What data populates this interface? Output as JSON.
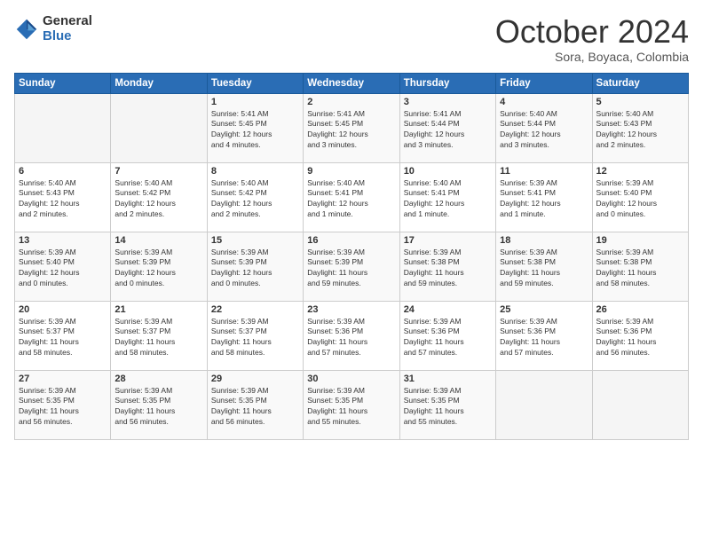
{
  "logo": {
    "general": "General",
    "blue": "Blue"
  },
  "header": {
    "month": "October 2024",
    "location": "Sora, Boyaca, Colombia"
  },
  "weekdays": [
    "Sunday",
    "Monday",
    "Tuesday",
    "Wednesday",
    "Thursday",
    "Friday",
    "Saturday"
  ],
  "weeks": [
    [
      {
        "day": "",
        "info": ""
      },
      {
        "day": "",
        "info": ""
      },
      {
        "day": "1",
        "info": "Sunrise: 5:41 AM\nSunset: 5:45 PM\nDaylight: 12 hours\nand 4 minutes."
      },
      {
        "day": "2",
        "info": "Sunrise: 5:41 AM\nSunset: 5:45 PM\nDaylight: 12 hours\nand 3 minutes."
      },
      {
        "day": "3",
        "info": "Sunrise: 5:41 AM\nSunset: 5:44 PM\nDaylight: 12 hours\nand 3 minutes."
      },
      {
        "day": "4",
        "info": "Sunrise: 5:40 AM\nSunset: 5:44 PM\nDaylight: 12 hours\nand 3 minutes."
      },
      {
        "day": "5",
        "info": "Sunrise: 5:40 AM\nSunset: 5:43 PM\nDaylight: 12 hours\nand 2 minutes."
      }
    ],
    [
      {
        "day": "6",
        "info": "Sunrise: 5:40 AM\nSunset: 5:43 PM\nDaylight: 12 hours\nand 2 minutes."
      },
      {
        "day": "7",
        "info": "Sunrise: 5:40 AM\nSunset: 5:42 PM\nDaylight: 12 hours\nand 2 minutes."
      },
      {
        "day": "8",
        "info": "Sunrise: 5:40 AM\nSunset: 5:42 PM\nDaylight: 12 hours\nand 2 minutes."
      },
      {
        "day": "9",
        "info": "Sunrise: 5:40 AM\nSunset: 5:41 PM\nDaylight: 12 hours\nand 1 minute."
      },
      {
        "day": "10",
        "info": "Sunrise: 5:40 AM\nSunset: 5:41 PM\nDaylight: 12 hours\nand 1 minute."
      },
      {
        "day": "11",
        "info": "Sunrise: 5:39 AM\nSunset: 5:41 PM\nDaylight: 12 hours\nand 1 minute."
      },
      {
        "day": "12",
        "info": "Sunrise: 5:39 AM\nSunset: 5:40 PM\nDaylight: 12 hours\nand 0 minutes."
      }
    ],
    [
      {
        "day": "13",
        "info": "Sunrise: 5:39 AM\nSunset: 5:40 PM\nDaylight: 12 hours\nand 0 minutes."
      },
      {
        "day": "14",
        "info": "Sunrise: 5:39 AM\nSunset: 5:39 PM\nDaylight: 12 hours\nand 0 minutes."
      },
      {
        "day": "15",
        "info": "Sunrise: 5:39 AM\nSunset: 5:39 PM\nDaylight: 12 hours\nand 0 minutes."
      },
      {
        "day": "16",
        "info": "Sunrise: 5:39 AM\nSunset: 5:39 PM\nDaylight: 11 hours\nand 59 minutes."
      },
      {
        "day": "17",
        "info": "Sunrise: 5:39 AM\nSunset: 5:38 PM\nDaylight: 11 hours\nand 59 minutes."
      },
      {
        "day": "18",
        "info": "Sunrise: 5:39 AM\nSunset: 5:38 PM\nDaylight: 11 hours\nand 59 minutes."
      },
      {
        "day": "19",
        "info": "Sunrise: 5:39 AM\nSunset: 5:38 PM\nDaylight: 11 hours\nand 58 minutes."
      }
    ],
    [
      {
        "day": "20",
        "info": "Sunrise: 5:39 AM\nSunset: 5:37 PM\nDaylight: 11 hours\nand 58 minutes."
      },
      {
        "day": "21",
        "info": "Sunrise: 5:39 AM\nSunset: 5:37 PM\nDaylight: 11 hours\nand 58 minutes."
      },
      {
        "day": "22",
        "info": "Sunrise: 5:39 AM\nSunset: 5:37 PM\nDaylight: 11 hours\nand 58 minutes."
      },
      {
        "day": "23",
        "info": "Sunrise: 5:39 AM\nSunset: 5:36 PM\nDaylight: 11 hours\nand 57 minutes."
      },
      {
        "day": "24",
        "info": "Sunrise: 5:39 AM\nSunset: 5:36 PM\nDaylight: 11 hours\nand 57 minutes."
      },
      {
        "day": "25",
        "info": "Sunrise: 5:39 AM\nSunset: 5:36 PM\nDaylight: 11 hours\nand 57 minutes."
      },
      {
        "day": "26",
        "info": "Sunrise: 5:39 AM\nSunset: 5:36 PM\nDaylight: 11 hours\nand 56 minutes."
      }
    ],
    [
      {
        "day": "27",
        "info": "Sunrise: 5:39 AM\nSunset: 5:35 PM\nDaylight: 11 hours\nand 56 minutes."
      },
      {
        "day": "28",
        "info": "Sunrise: 5:39 AM\nSunset: 5:35 PM\nDaylight: 11 hours\nand 56 minutes."
      },
      {
        "day": "29",
        "info": "Sunrise: 5:39 AM\nSunset: 5:35 PM\nDaylight: 11 hours\nand 56 minutes."
      },
      {
        "day": "30",
        "info": "Sunrise: 5:39 AM\nSunset: 5:35 PM\nDaylight: 11 hours\nand 55 minutes."
      },
      {
        "day": "31",
        "info": "Sunrise: 5:39 AM\nSunset: 5:35 PM\nDaylight: 11 hours\nand 55 minutes."
      },
      {
        "day": "",
        "info": ""
      },
      {
        "day": "",
        "info": ""
      }
    ]
  ]
}
